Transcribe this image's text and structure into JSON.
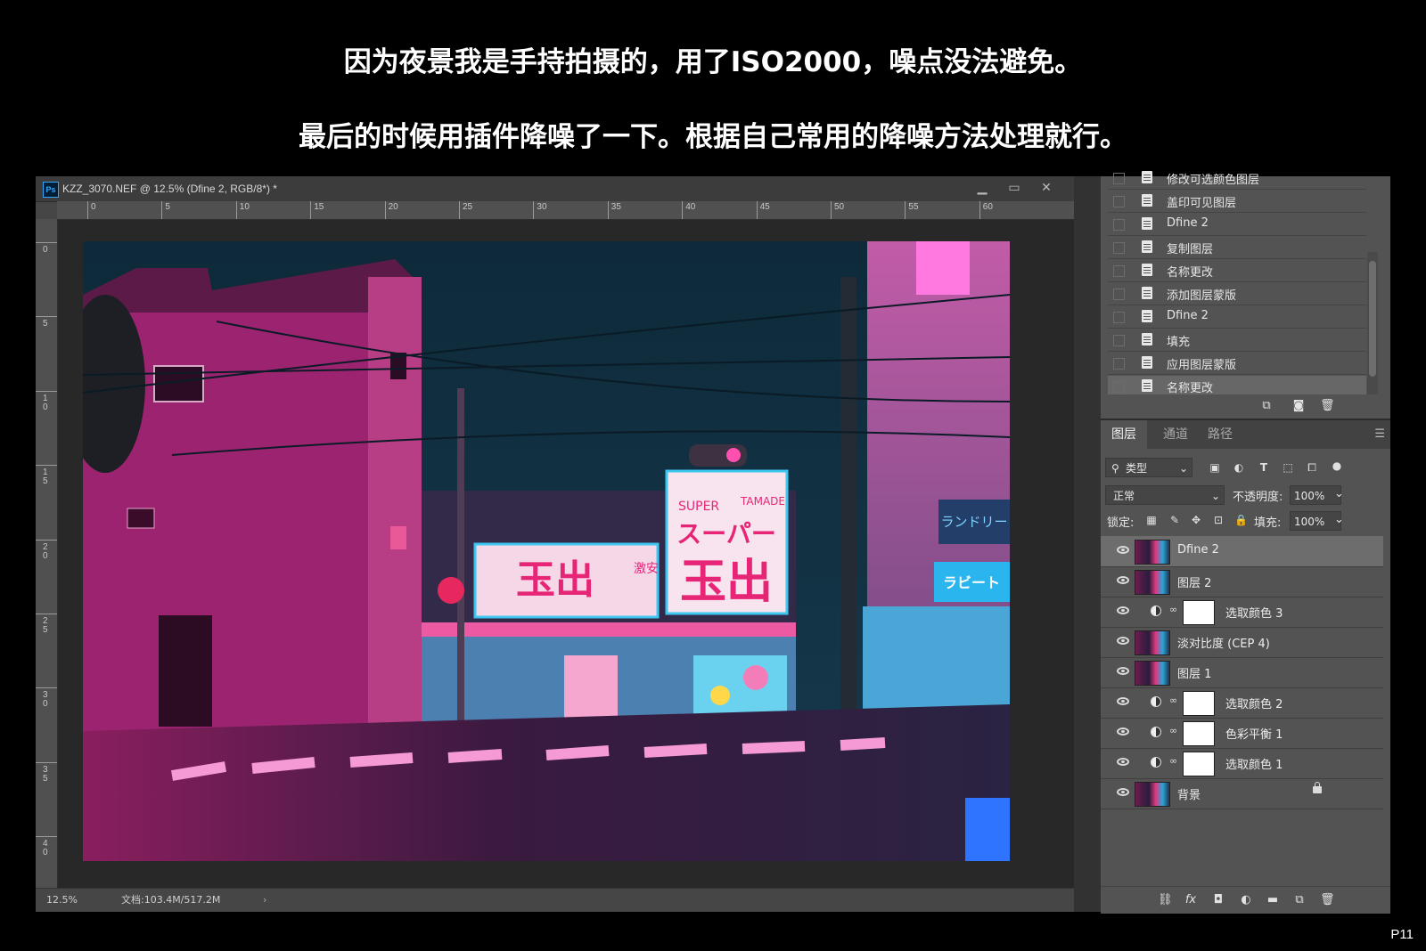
{
  "captions": {
    "line1": "因为夜景我是手持拍摄的，用了ISO2000，噪点没法避免。",
    "line2": "最后的时候用插件降噪了一下。根据自己常用的降噪方法处理就行。"
  },
  "page_number": "P11",
  "document": {
    "app_badge": "Ps",
    "title": "KZZ_3070.NEF @ 12.5% (Dfine 2, RGB/8*) *",
    "window_buttons": {
      "minimize": "▁",
      "restore": "▭",
      "close": "✕"
    },
    "ruler_h": [
      "0",
      "5",
      "10",
      "15",
      "20",
      "25",
      "30",
      "35",
      "40",
      "45",
      "50",
      "55",
      "60"
    ],
    "ruler_v": [
      "0",
      "5",
      "10",
      "15",
      "20",
      "25",
      "30",
      "35",
      "40"
    ],
    "status": {
      "zoom": "12.5%",
      "doc_size": "文档:103.4M/517.2M",
      "arrow": "›"
    },
    "photo": {
      "sign_super": "SUPER",
      "sign_tamade": "TAMADE",
      "sign_kana": "スーパー",
      "sign_kanji": "玉出",
      "sign_gekiyasu": "激安",
      "sign_laundry": "ランドリー",
      "sign_rabbit": "ラビート",
      "colors": {
        "magenta": "#d8337f",
        "cyan": "#3cc6f0",
        "sky": "#0f2b3c"
      }
    }
  },
  "history": {
    "items": [
      {
        "label": "修改可选颜色图层"
      },
      {
        "label": "盖印可见图层"
      },
      {
        "label": "Dfine 2"
      },
      {
        "label": "复制图层"
      },
      {
        "label": "名称更改"
      },
      {
        "label": "添加图层蒙版"
      },
      {
        "label": "Dfine 2"
      },
      {
        "label": "填充"
      },
      {
        "label": "应用图层蒙版"
      },
      {
        "label": "名称更改"
      }
    ],
    "active_index": 9,
    "tools": [
      "new-document-icon",
      "camera-icon",
      "trash-icon"
    ]
  },
  "layers_panel": {
    "tabs": [
      "图层",
      "通道",
      "路径"
    ],
    "active_tab": 0,
    "filter": {
      "label": "类型"
    },
    "blend_mode": "正常",
    "opacity_label": "不透明度:",
    "opacity_value": "100%",
    "lock_label": "锁定:",
    "fill_label": "填充:",
    "fill_value": "100%",
    "layers": [
      {
        "name": "Dfine 2",
        "kind": "pixel",
        "selected": true
      },
      {
        "name": "图层 2",
        "kind": "pixel"
      },
      {
        "name": "选取颜色 3",
        "kind": "adjustment"
      },
      {
        "name": "淡对比度 (CEP 4)",
        "kind": "pixel"
      },
      {
        "name": "图层 1",
        "kind": "pixel"
      },
      {
        "name": "选取颜色 2",
        "kind": "adjustment"
      },
      {
        "name": "色彩平衡 1",
        "kind": "adjustment"
      },
      {
        "name": "选取颜色 1",
        "kind": "adjustment"
      },
      {
        "name": "背景",
        "kind": "background",
        "locked": true
      }
    ],
    "bottom_tools": [
      "link-icon",
      "fx-icon",
      "mask-icon",
      "adjustment-icon",
      "folder-icon",
      "new-layer-icon",
      "trash-icon"
    ],
    "fx_glyph": "fx"
  }
}
